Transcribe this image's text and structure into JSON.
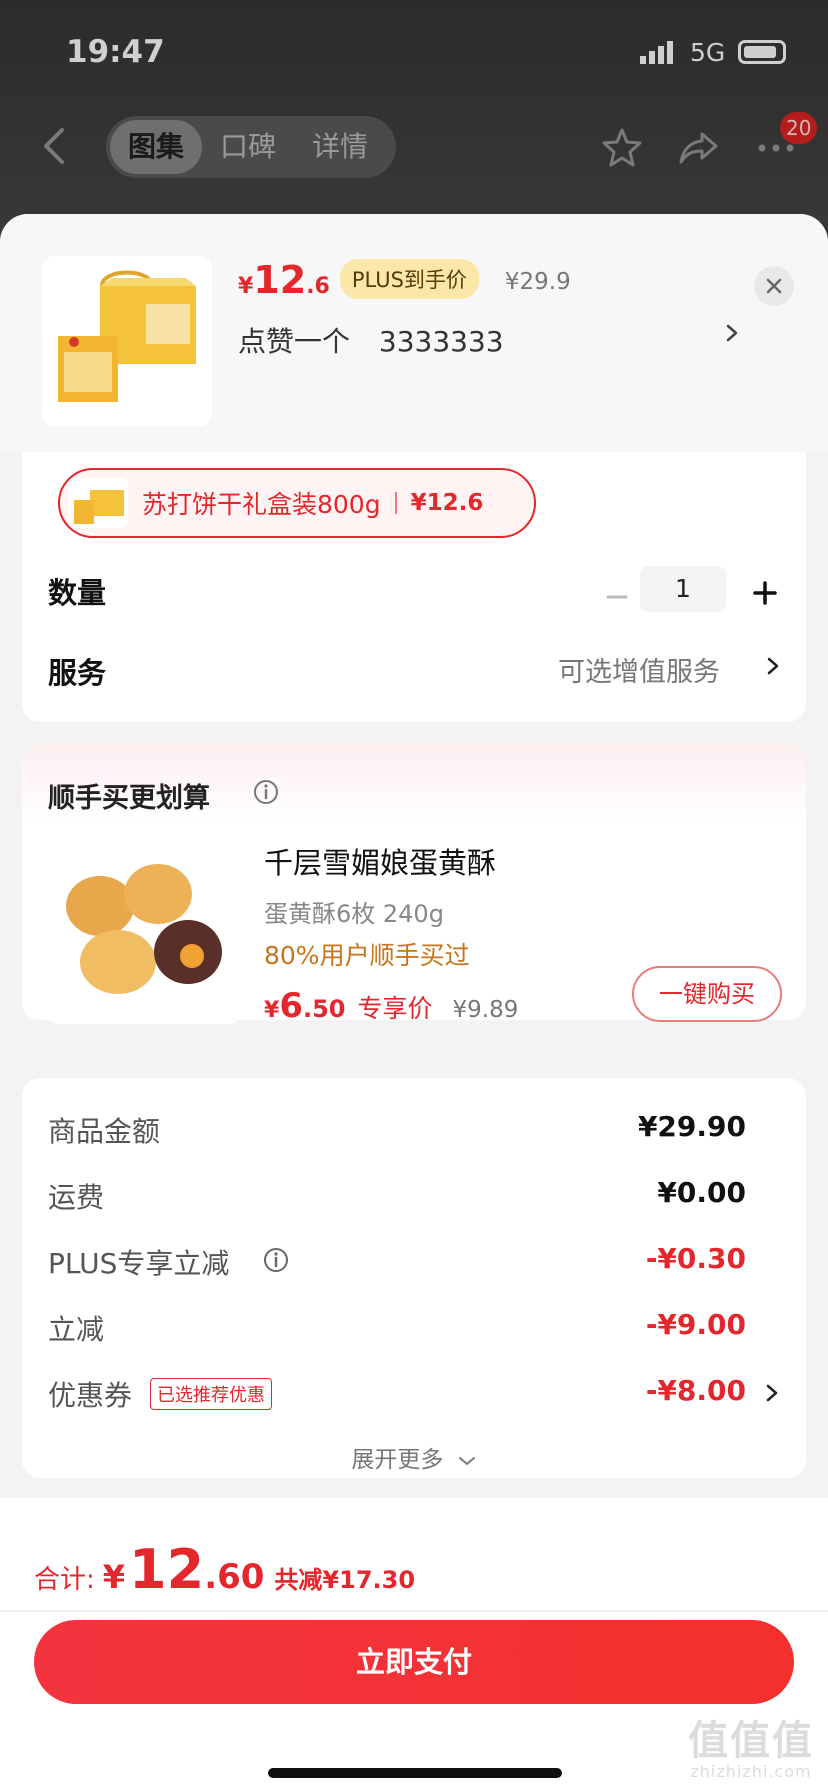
{
  "status_bar": {
    "time": "19:47",
    "network": "5G"
  },
  "nav": {
    "tabs": [
      {
        "label": "图集",
        "active": true
      },
      {
        "label": "口碑",
        "active": false
      },
      {
        "label": "详情",
        "active": false
      }
    ],
    "badge_count": "20",
    "icons": [
      "back-icon",
      "star-icon",
      "share-icon",
      "more-icon"
    ]
  },
  "sku": {
    "price_currency": "¥",
    "price_int": "12",
    "price_dec": ".6",
    "plus_badge": "PLUS到手价",
    "orig_price": "¥29.9",
    "spec_prefix": "点赞一个",
    "spec_value": "3333333"
  },
  "selected_sku": {
    "name": "苏打饼干礼盒装800g",
    "price": "¥12.6"
  },
  "quantity": {
    "label": "数量",
    "value": "1"
  },
  "service": {
    "label": "服务",
    "value": "可选增值服务"
  },
  "addon": {
    "title": "顺手买更划算",
    "name": "千层雪媚娘蛋黄酥",
    "spec": "蛋黄酥6枚 240g",
    "social": "80%用户顺手买过",
    "price_currency": "¥",
    "price_int": "6",
    "price_dec": ".50",
    "price_tag": "专享价",
    "orig_price": "¥9.89",
    "buy_label": "一键购买"
  },
  "summary": {
    "rows": [
      {
        "label": "商品金额",
        "value": "¥29.90"
      },
      {
        "label": "运费",
        "value": "¥0.00"
      },
      {
        "label": "PLUS专享立减",
        "value": "-¥0.30"
      },
      {
        "label": "立减",
        "value": "-¥9.00"
      },
      {
        "label": "优惠券",
        "value": "-¥8.00",
        "tag": "已选推荐优惠"
      }
    ],
    "expand_label": "展开更多"
  },
  "footer": {
    "total_label": "合计:",
    "total_currency": "¥",
    "total_int": "12",
    "total_dec": ".60",
    "saving": "共减¥17.30",
    "pay_label": "立即支付"
  },
  "watermark": {
    "glyphs": "值值值",
    "site": "zhizhizhi.com"
  },
  "colors": {
    "accent": "#e4272c",
    "plus_badge_bg": "#fbe7a8",
    "social_proof": "#c8741a"
  }
}
